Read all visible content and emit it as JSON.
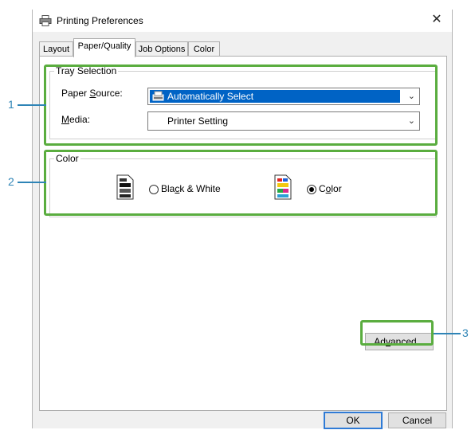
{
  "window": {
    "title": "Printing Preferences",
    "close_glyph": "✕"
  },
  "tabs": [
    {
      "label": "Layout"
    },
    {
      "label": "Paper/Quality"
    },
    {
      "label": "Job Options"
    },
    {
      "label": "Color"
    }
  ],
  "tray": {
    "group_label": "Tray Selection",
    "paper_source_pre": "Paper ",
    "paper_source_mn": "S",
    "paper_source_post": "ource:",
    "paper_source_value": "Automatically Select",
    "media_mn": "M",
    "media_post": "edia:",
    "media_value": "Printer Setting"
  },
  "color": {
    "group_label": "Color",
    "bw_pre": "Bla",
    "bw_mn": "c",
    "bw_post": "k & White",
    "color_pre": "C",
    "color_mn": "o",
    "color_post": "lor",
    "selected": "Color"
  },
  "buttons": {
    "advanced_pre": "Ad",
    "advanced_mn": "v",
    "advanced_post": "anced...",
    "ok": "OK",
    "cancel": "Cancel"
  },
  "callouts": [
    "1",
    "2",
    "3"
  ],
  "colors": {
    "highlight": "#5aad3f",
    "callout": "#2e84b6",
    "selection": "#0063c5"
  }
}
